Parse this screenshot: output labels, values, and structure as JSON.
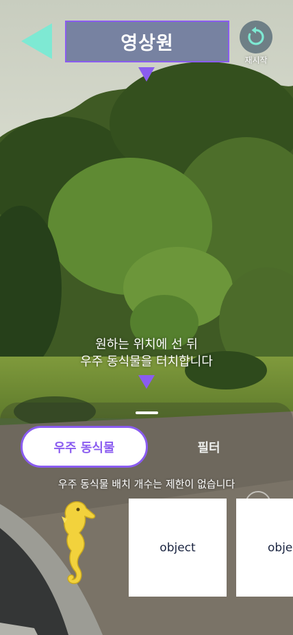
{
  "header": {
    "back_icon": "back-arrow-icon",
    "title": "영상원",
    "restart_label": "재시작",
    "restart_icon": "restart-icon"
  },
  "hint": {
    "line1": "원하는 위치에 선 뒤",
    "line2": "우주 동식물을 터치합니다"
  },
  "panel": {
    "tabs": [
      {
        "label": "우주 동식물",
        "active": true
      },
      {
        "label": "필터",
        "active": false
      }
    ],
    "limit_text": "우주 동식물 배치 개수는 제한이 없습니다",
    "items": [
      {
        "icon": "seahorse-icon"
      },
      {
        "label": "object"
      },
      {
        "label": "object"
      }
    ]
  },
  "colors": {
    "accent": "#8a5cf0",
    "back_arrow": "#7ee9d3",
    "title_box": "#707c9e",
    "restart_arrow": "#7ee9d3"
  }
}
